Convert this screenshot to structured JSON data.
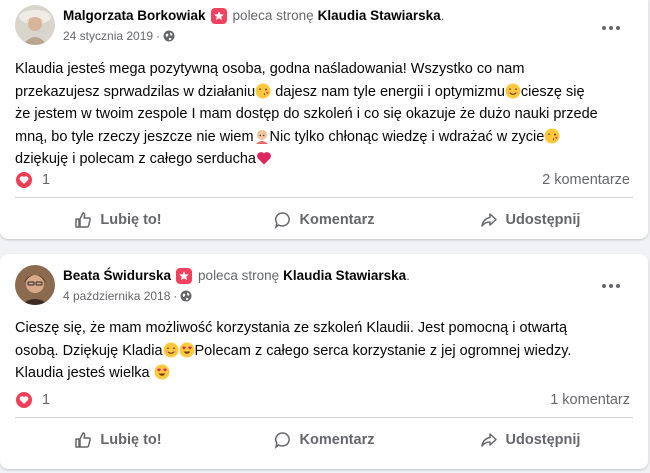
{
  "posts": [
    {
      "author": "Malgorzata Borkowiak",
      "verb": "poleca stronę",
      "page": "Klaudia Stawiarska",
      "date": "24 stycznia 2019",
      "separator": "·",
      "text": [
        "Klaudia jesteś mega pozytywną osoba, godna naśladowania! Wszystko co nam",
        "przekazujesz sprwadzilas w działaniu",
        " dajesz nam tyle energii i optymizmu",
        "cieszę się",
        "że jestem w twoim zespole I mam dostęp do szkoleń i co się okazuje że dużo nauki przede",
        "mną, bo tyle rzeczy jeszcze nie wiem",
        "Nic tylko chłonąc wiedzę i wdrażać w zycie",
        "dziękuję i polecam z całego serducha"
      ],
      "reactions_count": "1",
      "comments_label": "2 komentarze"
    },
    {
      "author": "Beata Świdurska",
      "verb": "poleca stronę",
      "page": "Klaudia Stawiarska",
      "date": "4 października 2018",
      "separator": "·",
      "text": [
        "Cieszę się, że mam możliwość korzystania ze szkoleń Klaudii. Jest pomocną i otwartą",
        "osobą. Dziękuję Kladia",
        "Polecam z całego serca korzystanie z jej ogromnej wiedzy.",
        "Klaudia jesteś wielka "
      ],
      "reactions_count": "1",
      "comments_label": "1 komentarz"
    }
  ],
  "actions": {
    "like": "Lubię to!",
    "comment": "Komentarz",
    "share": "Udostępnij"
  },
  "colors": {
    "recommend_badge": "#f3425f",
    "heart": "#f33e58",
    "secondary_text": "#65676b"
  }
}
